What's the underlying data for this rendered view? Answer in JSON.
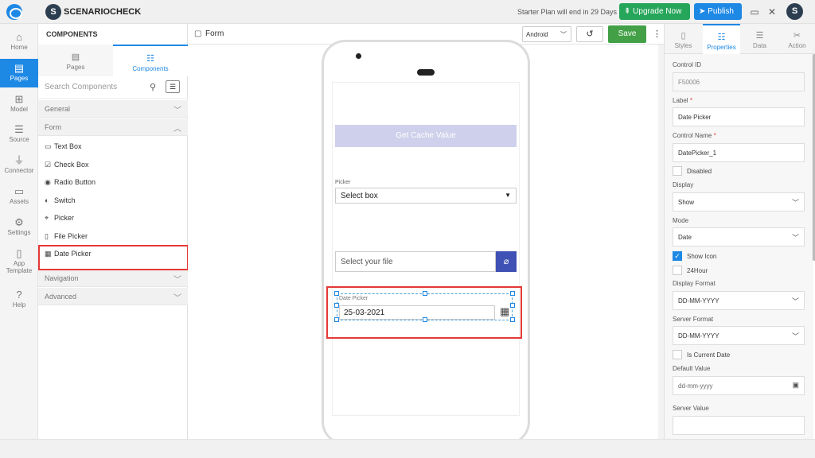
{
  "app": {
    "name": "SCENARIOCHECK",
    "badge": "S",
    "plan_text": "Starter Plan will end in 29 Days",
    "upgrade_label": "Upgrade Now",
    "publish_label": "Publish",
    "avatar": "S"
  },
  "rail": [
    {
      "label": "Home",
      "icon": "home-icon"
    },
    {
      "label": "Pages",
      "icon": "pages-icon",
      "active": true
    },
    {
      "label": "Model",
      "icon": "model-icon"
    },
    {
      "label": "Source",
      "icon": "database-icon"
    },
    {
      "label": "Connector",
      "icon": "plug-icon"
    },
    {
      "label": "Assets",
      "icon": "assets-icon"
    },
    {
      "label": "Settings",
      "icon": "gear-icon"
    },
    {
      "label": "App",
      "label2": "Template",
      "icon": "template-icon"
    },
    {
      "label": "Help",
      "icon": "help-icon"
    }
  ],
  "components": {
    "title": "COMPONENTS",
    "tabs": [
      "Pages",
      "Components"
    ],
    "search_placeholder": "Search Components",
    "sections": {
      "general": "General",
      "form": "Form",
      "navigation": "Navigation",
      "advanced": "Advanced"
    },
    "form_items": [
      "Text Box",
      "Check Box",
      "Radio Button",
      "Switch",
      "Picker",
      "File Picker",
      "Date Picker"
    ]
  },
  "canvas": {
    "title": "Form",
    "device": "Android",
    "save_label": "Save",
    "cache_button": "Get Cache Value",
    "picker_label": "Picker",
    "picker_value": "Select box",
    "file_placeholder": "Select your file",
    "datepicker_label": "Date Picker",
    "datepicker_value": "25-03-2021"
  },
  "props": {
    "tabs": [
      "Styles",
      "Properties",
      "Data",
      "Action"
    ],
    "active_tab": "Properties",
    "control_id_label": "Control ID",
    "control_id": "F50006",
    "label_label": "Label",
    "label_value": "Date Picker",
    "control_name_label": "Control Name",
    "control_name": "DatePicker_1",
    "disabled_label": "Disabled",
    "display_label": "Display",
    "display_value": "Show",
    "mode_label": "Mode",
    "mode_value": "Date",
    "show_icon_label": "Show Icon",
    "hour24_label": "24Hour",
    "display_format_label": "Display Format",
    "display_format": "DD-MM-YYYY",
    "server_format_label": "Server Format",
    "server_format": "DD-MM-YYYY",
    "is_current_label": "Is Current Date",
    "default_value_label": "Default Value",
    "default_value_placeholder": "dd-mm-yyyy",
    "server_value_label": "Server Value"
  },
  "colors": {
    "accent": "#1e88e5",
    "save": "#43a047",
    "upgrade": "#26a65b",
    "highlight": "#e53935",
    "cache_btn": "#cfd0eb",
    "file_btn": "#3f51b5"
  }
}
